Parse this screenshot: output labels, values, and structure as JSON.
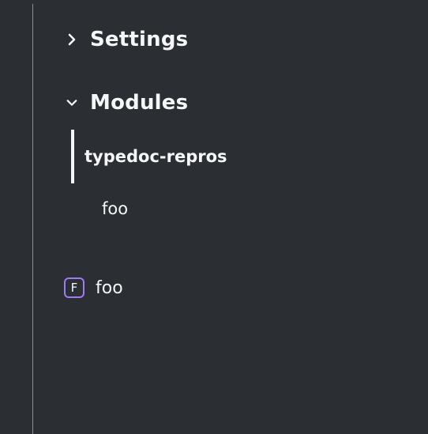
{
  "sidebar": {
    "settings": {
      "label": "Settings",
      "icon": "chevron-right-icon",
      "expanded": false
    },
    "modules": {
      "label": "Modules",
      "icon": "chevron-down-icon",
      "expanded": true,
      "items": [
        {
          "label": "typedoc-repros",
          "active": true
        },
        {
          "label": "foo",
          "active": false
        }
      ]
    },
    "members": [
      {
        "kind_letter": "F",
        "label": "foo",
        "kind_color": "#9d7cf2"
      }
    ]
  },
  "colors": {
    "background": "#2b2e33",
    "text": "#f5f6f8",
    "divider": "#8e9095",
    "function_kind": "#9d7cf2"
  }
}
